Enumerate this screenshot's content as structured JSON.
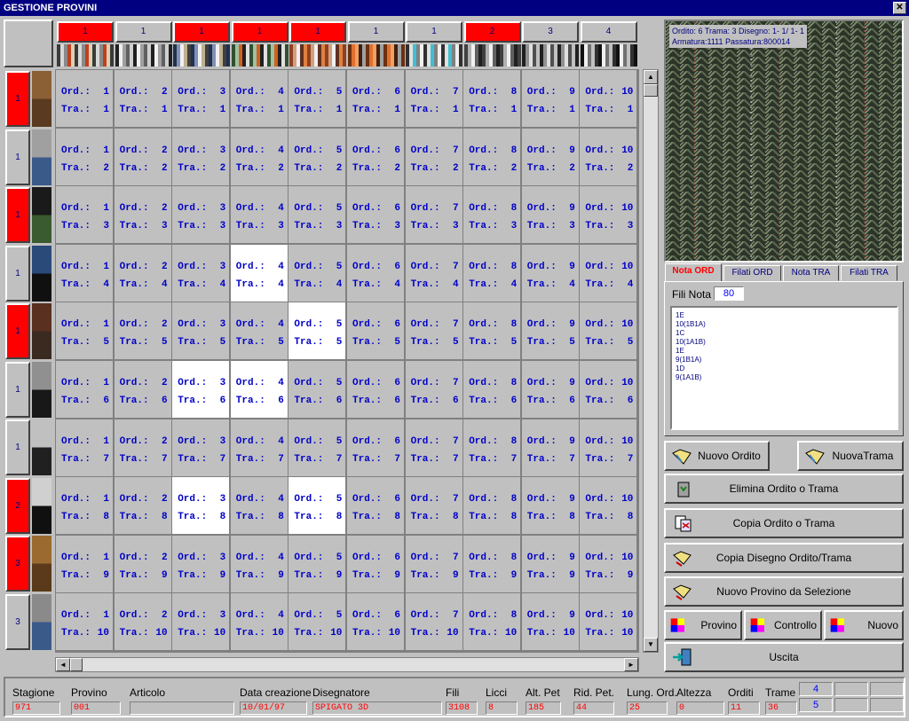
{
  "window": {
    "title": "GESTIONE PROVINI",
    "close": "✕"
  },
  "warp_headers": [
    {
      "label": "1",
      "color": "#ff0000",
      "text_color": "#000080"
    },
    {
      "label": "1",
      "color": "#c0c0c0",
      "text_color": "#000080"
    },
    {
      "label": "1",
      "color": "#ff0000",
      "text_color": "#000080"
    },
    {
      "label": "1",
      "color": "#ff0000",
      "text_color": "#000080"
    },
    {
      "label": "1",
      "color": "#ff0000",
      "text_color": "#000080"
    },
    {
      "label": "1",
      "color": "#c0c0c0",
      "text_color": "#000080"
    },
    {
      "label": "1",
      "color": "#c0c0c0",
      "text_color": "#000080"
    },
    {
      "label": "2",
      "color": "#ff0000",
      "text_color": "#000080"
    },
    {
      "label": "3",
      "color": "#c0c0c0",
      "text_color": "#000080"
    },
    {
      "label": "4",
      "color": "#c0c0c0",
      "text_color": "#000080"
    }
  ],
  "warp_strips": [
    [
      "#3a3a3a",
      "#d8d8d8",
      "#8a8a8a",
      "#c04020",
      "#e0d0b0"
    ],
    [
      "#202020",
      "#f0f0f0",
      "#a0a0a0",
      "#606060",
      "#d0d0d0"
    ],
    [
      "#203050",
      "#8090b0",
      "#f0f0f0",
      "#c0b090",
      "#404040"
    ],
    [
      "#305030",
      "#a0c0a0",
      "#d06020",
      "#202020",
      "#e0e0e0"
    ],
    [
      "#904020",
      "#d0a080",
      "#f0f0f0",
      "#603020",
      "#e08040"
    ],
    [
      "#6a3010",
      "#e07030",
      "#f0a060",
      "#402010",
      "#a0a0a0"
    ],
    [
      "#303030",
      "#e0e0e0",
      "#40c0d0",
      "#808080",
      "#f0f0f0"
    ],
    [
      "#404040",
      "#b0b0b0",
      "#f0f0f0",
      "#606060",
      "#202020"
    ],
    [
      "#202020",
      "#909090",
      "#e0e0e0",
      "#505050",
      "#c0c0c0"
    ],
    [
      "#101010",
      "#f0f0f0",
      "#707070",
      "#c0c0c0",
      "#303030"
    ]
  ],
  "weft_headers": [
    {
      "label": "1",
      "color": "#ff0000"
    },
    {
      "label": "1",
      "color": "#c0c0c0"
    },
    {
      "label": "1",
      "color": "#ff0000"
    },
    {
      "label": "1",
      "color": "#c0c0c0"
    },
    {
      "label": "1",
      "color": "#ff0000"
    },
    {
      "label": "1",
      "color": "#c0c0c0"
    },
    {
      "label": "1",
      "color": "#c0c0c0"
    },
    {
      "label": "2",
      "color": "#ff0000"
    },
    {
      "label": "3",
      "color": "#ff0000"
    },
    {
      "label": "3",
      "color": "#c0c0c0"
    }
  ],
  "weft_strips": [
    [
      "#8b6035",
      "#5a3a20"
    ],
    [
      "#a0a0a0",
      "#3a5a8a"
    ],
    [
      "#1a1a1a",
      "#3a5a30"
    ],
    [
      "#2a4a7a",
      "#101010"
    ],
    [
      "#5a3020",
      "#3a2a20"
    ],
    [
      "#909090",
      "#181818"
    ],
    [
      "#c0c0c0",
      "#202020"
    ],
    [
      "#d0d0d0",
      "#101010"
    ],
    [
      "#9a6a30",
      "#5a3a1a"
    ],
    [
      "#8a8a8a",
      "#3a5a8a"
    ]
  ],
  "grid": {
    "ord_label": "Ord.:",
    "tra_label": "Tra.:",
    "selected": [
      [
        4,
        4
      ],
      [
        5,
        5
      ],
      [
        6,
        3
      ],
      [
        6,
        4
      ],
      [
        8,
        3
      ],
      [
        8,
        5
      ]
    ]
  },
  "preview": {
    "line1": "Ordito: 6   Trama: 3   Disegno:  1- 1/ 1- 1",
    "line2": "Armatura:1111     Passatura:800014"
  },
  "tabs": [
    {
      "label": "Nota ORD",
      "active": true
    },
    {
      "label": "Filati ORD",
      "active": false
    },
    {
      "label": "Nota TRA",
      "active": false
    },
    {
      "label": "Filati TRA",
      "active": false
    }
  ],
  "nota": {
    "fili_label": "Fili Nota",
    "fili_value": "80",
    "lines": [
      "1E",
      "10(1B1A)",
      "1C",
      "10(1A1B)",
      "1E",
      "9(1B1A)",
      "1D",
      "9(1A1B)"
    ]
  },
  "buttons": {
    "nuovo_ordito": "Nuovo Ordito",
    "nuova_trama": "NuovaTrama",
    "elimina": "Elimina Ordito o Trama",
    "copia": "Copia Ordito o Trama",
    "copia_disegno": "Copia Disegno Ordito/Trama",
    "nuovo_provino": "Nuovo Provino da Selezione",
    "provino": "Provino",
    "controllo": "Controllo",
    "nuovo": "Nuovo",
    "uscita": "Uscita"
  },
  "status": {
    "stagione": {
      "label": "Stagione",
      "value": "971"
    },
    "provino": {
      "label": "Provino",
      "value": "001"
    },
    "articolo": {
      "label": "Articolo",
      "value": ""
    },
    "data": {
      "label": "Data creazione",
      "value": "10/01/97"
    },
    "disegnatore": {
      "label": "Disegnatore",
      "value": "SPIGATO 3D"
    },
    "fili": {
      "label": "Fili",
      "value": "3108"
    },
    "licci": {
      "label": "Licci",
      "value": "8"
    },
    "alt_pet": {
      "label": "Alt. Pet",
      "value": "185"
    },
    "rid_pet": {
      "label": "Rid. Pet.",
      "value": "44"
    },
    "lung_ord": {
      "label": "Lung. Ord.",
      "value": "25"
    },
    "altezza": {
      "label": "Altezza",
      "value": "0"
    },
    "orditi": {
      "label": "Orditi",
      "value": "11"
    },
    "trame": {
      "label": "Trame",
      "value": "36"
    },
    "box1": "4",
    "box2": "5"
  }
}
